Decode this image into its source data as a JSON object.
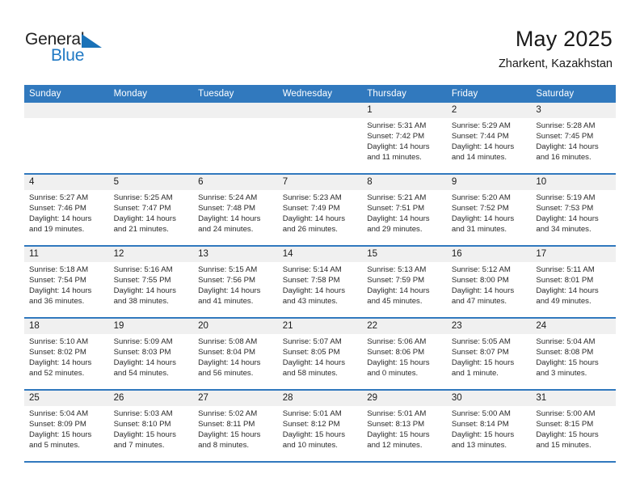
{
  "brand": {
    "name_top": "General",
    "name_bottom": "Blue",
    "accent_color": "#2079c4"
  },
  "header": {
    "title": "May 2025",
    "subtitle": "Zharkent, Kazakhstan"
  },
  "calendar": {
    "header_bg": "#3179be",
    "daynum_bg": "#f0f0f0",
    "weekday_headers": [
      "Sunday",
      "Monday",
      "Tuesday",
      "Wednesday",
      "Thursday",
      "Friday",
      "Saturday"
    ],
    "weeks": [
      [
        {
          "day": "",
          "lines": []
        },
        {
          "day": "",
          "lines": []
        },
        {
          "day": "",
          "lines": []
        },
        {
          "day": "",
          "lines": []
        },
        {
          "day": "1",
          "lines": [
            "Sunrise: 5:31 AM",
            "Sunset: 7:42 PM",
            "Daylight: 14 hours",
            "and 11 minutes."
          ]
        },
        {
          "day": "2",
          "lines": [
            "Sunrise: 5:29 AM",
            "Sunset: 7:44 PM",
            "Daylight: 14 hours",
            "and 14 minutes."
          ]
        },
        {
          "day": "3",
          "lines": [
            "Sunrise: 5:28 AM",
            "Sunset: 7:45 PM",
            "Daylight: 14 hours",
            "and 16 minutes."
          ]
        }
      ],
      [
        {
          "day": "4",
          "lines": [
            "Sunrise: 5:27 AM",
            "Sunset: 7:46 PM",
            "Daylight: 14 hours",
            "and 19 minutes."
          ]
        },
        {
          "day": "5",
          "lines": [
            "Sunrise: 5:25 AM",
            "Sunset: 7:47 PM",
            "Daylight: 14 hours",
            "and 21 minutes."
          ]
        },
        {
          "day": "6",
          "lines": [
            "Sunrise: 5:24 AM",
            "Sunset: 7:48 PM",
            "Daylight: 14 hours",
            "and 24 minutes."
          ]
        },
        {
          "day": "7",
          "lines": [
            "Sunrise: 5:23 AM",
            "Sunset: 7:49 PM",
            "Daylight: 14 hours",
            "and 26 minutes."
          ]
        },
        {
          "day": "8",
          "lines": [
            "Sunrise: 5:21 AM",
            "Sunset: 7:51 PM",
            "Daylight: 14 hours",
            "and 29 minutes."
          ]
        },
        {
          "day": "9",
          "lines": [
            "Sunrise: 5:20 AM",
            "Sunset: 7:52 PM",
            "Daylight: 14 hours",
            "and 31 minutes."
          ]
        },
        {
          "day": "10",
          "lines": [
            "Sunrise: 5:19 AM",
            "Sunset: 7:53 PM",
            "Daylight: 14 hours",
            "and 34 minutes."
          ]
        }
      ],
      [
        {
          "day": "11",
          "lines": [
            "Sunrise: 5:18 AM",
            "Sunset: 7:54 PM",
            "Daylight: 14 hours",
            "and 36 minutes."
          ]
        },
        {
          "day": "12",
          "lines": [
            "Sunrise: 5:16 AM",
            "Sunset: 7:55 PM",
            "Daylight: 14 hours",
            "and 38 minutes."
          ]
        },
        {
          "day": "13",
          "lines": [
            "Sunrise: 5:15 AM",
            "Sunset: 7:56 PM",
            "Daylight: 14 hours",
            "and 41 minutes."
          ]
        },
        {
          "day": "14",
          "lines": [
            "Sunrise: 5:14 AM",
            "Sunset: 7:58 PM",
            "Daylight: 14 hours",
            "and 43 minutes."
          ]
        },
        {
          "day": "15",
          "lines": [
            "Sunrise: 5:13 AM",
            "Sunset: 7:59 PM",
            "Daylight: 14 hours",
            "and 45 minutes."
          ]
        },
        {
          "day": "16",
          "lines": [
            "Sunrise: 5:12 AM",
            "Sunset: 8:00 PM",
            "Daylight: 14 hours",
            "and 47 minutes."
          ]
        },
        {
          "day": "17",
          "lines": [
            "Sunrise: 5:11 AM",
            "Sunset: 8:01 PM",
            "Daylight: 14 hours",
            "and 49 minutes."
          ]
        }
      ],
      [
        {
          "day": "18",
          "lines": [
            "Sunrise: 5:10 AM",
            "Sunset: 8:02 PM",
            "Daylight: 14 hours",
            "and 52 minutes."
          ]
        },
        {
          "day": "19",
          "lines": [
            "Sunrise: 5:09 AM",
            "Sunset: 8:03 PM",
            "Daylight: 14 hours",
            "and 54 minutes."
          ]
        },
        {
          "day": "20",
          "lines": [
            "Sunrise: 5:08 AM",
            "Sunset: 8:04 PM",
            "Daylight: 14 hours",
            "and 56 minutes."
          ]
        },
        {
          "day": "21",
          "lines": [
            "Sunrise: 5:07 AM",
            "Sunset: 8:05 PM",
            "Daylight: 14 hours",
            "and 58 minutes."
          ]
        },
        {
          "day": "22",
          "lines": [
            "Sunrise: 5:06 AM",
            "Sunset: 8:06 PM",
            "Daylight: 15 hours",
            "and 0 minutes."
          ]
        },
        {
          "day": "23",
          "lines": [
            "Sunrise: 5:05 AM",
            "Sunset: 8:07 PM",
            "Daylight: 15 hours",
            "and 1 minute."
          ]
        },
        {
          "day": "24",
          "lines": [
            "Sunrise: 5:04 AM",
            "Sunset: 8:08 PM",
            "Daylight: 15 hours",
            "and 3 minutes."
          ]
        }
      ],
      [
        {
          "day": "25",
          "lines": [
            "Sunrise: 5:04 AM",
            "Sunset: 8:09 PM",
            "Daylight: 15 hours",
            "and 5 minutes."
          ]
        },
        {
          "day": "26",
          "lines": [
            "Sunrise: 5:03 AM",
            "Sunset: 8:10 PM",
            "Daylight: 15 hours",
            "and 7 minutes."
          ]
        },
        {
          "day": "27",
          "lines": [
            "Sunrise: 5:02 AM",
            "Sunset: 8:11 PM",
            "Daylight: 15 hours",
            "and 8 minutes."
          ]
        },
        {
          "day": "28",
          "lines": [
            "Sunrise: 5:01 AM",
            "Sunset: 8:12 PM",
            "Daylight: 15 hours",
            "and 10 minutes."
          ]
        },
        {
          "day": "29",
          "lines": [
            "Sunrise: 5:01 AM",
            "Sunset: 8:13 PM",
            "Daylight: 15 hours",
            "and 12 minutes."
          ]
        },
        {
          "day": "30",
          "lines": [
            "Sunrise: 5:00 AM",
            "Sunset: 8:14 PM",
            "Daylight: 15 hours",
            "and 13 minutes."
          ]
        },
        {
          "day": "31",
          "lines": [
            "Sunrise: 5:00 AM",
            "Sunset: 8:15 PM",
            "Daylight: 15 hours",
            "and 15 minutes."
          ]
        }
      ]
    ]
  }
}
